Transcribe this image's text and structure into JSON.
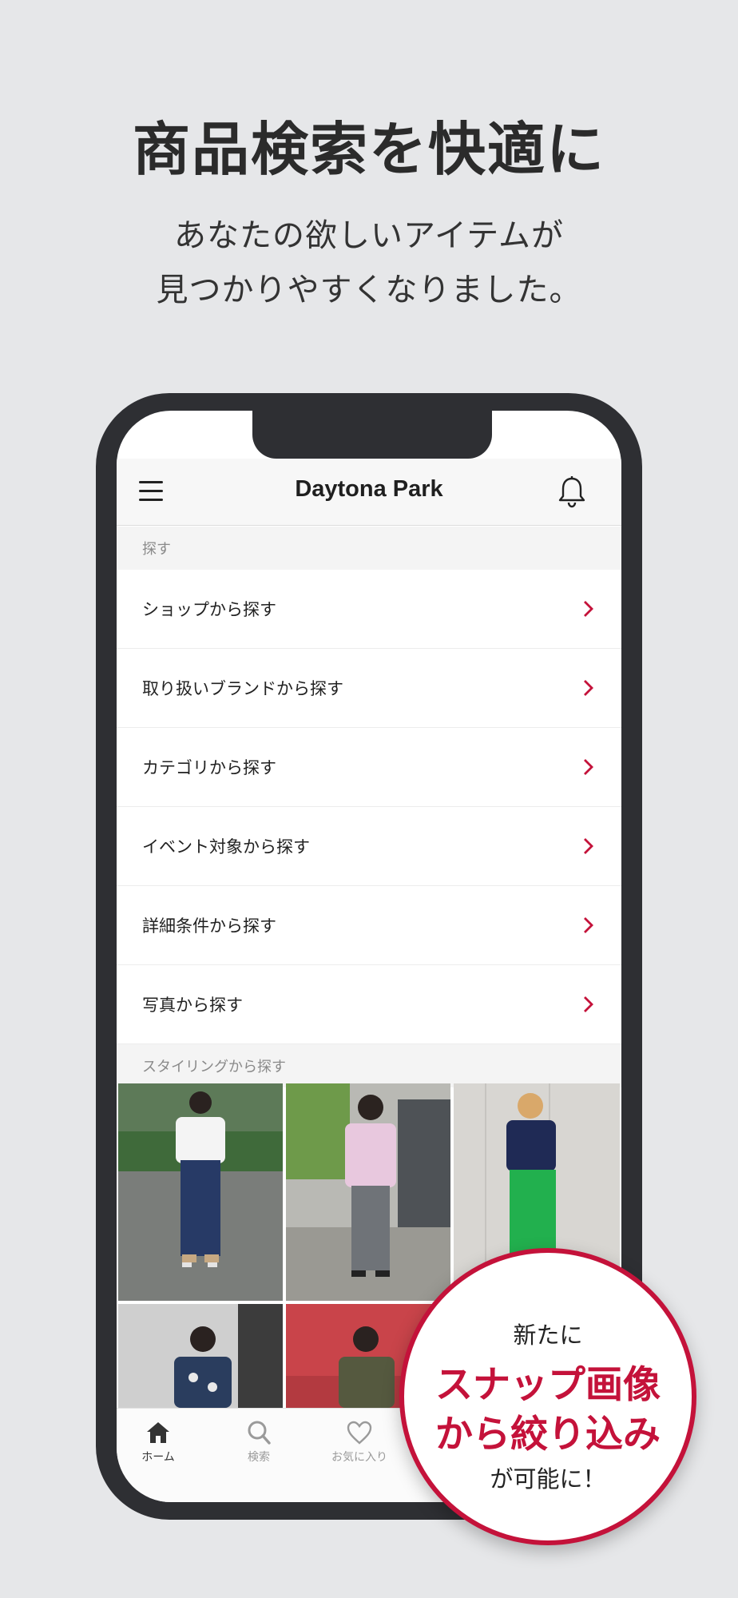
{
  "promo": {
    "headline": "商品検索を快適に",
    "subline_1": "あなたの欲しいアイテムが",
    "subline_2": "見つかりやすくなりました。"
  },
  "app": {
    "title": "Daytona Park",
    "menu_icon": "hamburger-menu-icon",
    "notification_icon": "bell-icon"
  },
  "search_section": {
    "label": "探す",
    "items": [
      {
        "label": "ショップから探す"
      },
      {
        "label": "取り扱いブランドから探す"
      },
      {
        "label": "カテゴリから探す"
      },
      {
        "label": "イベント対象から探す"
      },
      {
        "label": "詳細条件から探す"
      },
      {
        "label": "写真から探す"
      }
    ],
    "chevron_color": "#c4123a"
  },
  "styling_section": {
    "label": "スタイリングから探す"
  },
  "tabbar": {
    "tabs": [
      {
        "label": "ホーム",
        "icon": "home-icon",
        "active": true
      },
      {
        "label": "検索",
        "icon": "search-icon",
        "active": false
      },
      {
        "label": "お気に入り",
        "icon": "heart-icon",
        "active": false
      }
    ]
  },
  "badge": {
    "line_1": "新たに",
    "line_2": "スナップ画像",
    "line_3": "から絞り込み",
    "line_4": "が可能に！",
    "accent_color": "#c4123a"
  }
}
